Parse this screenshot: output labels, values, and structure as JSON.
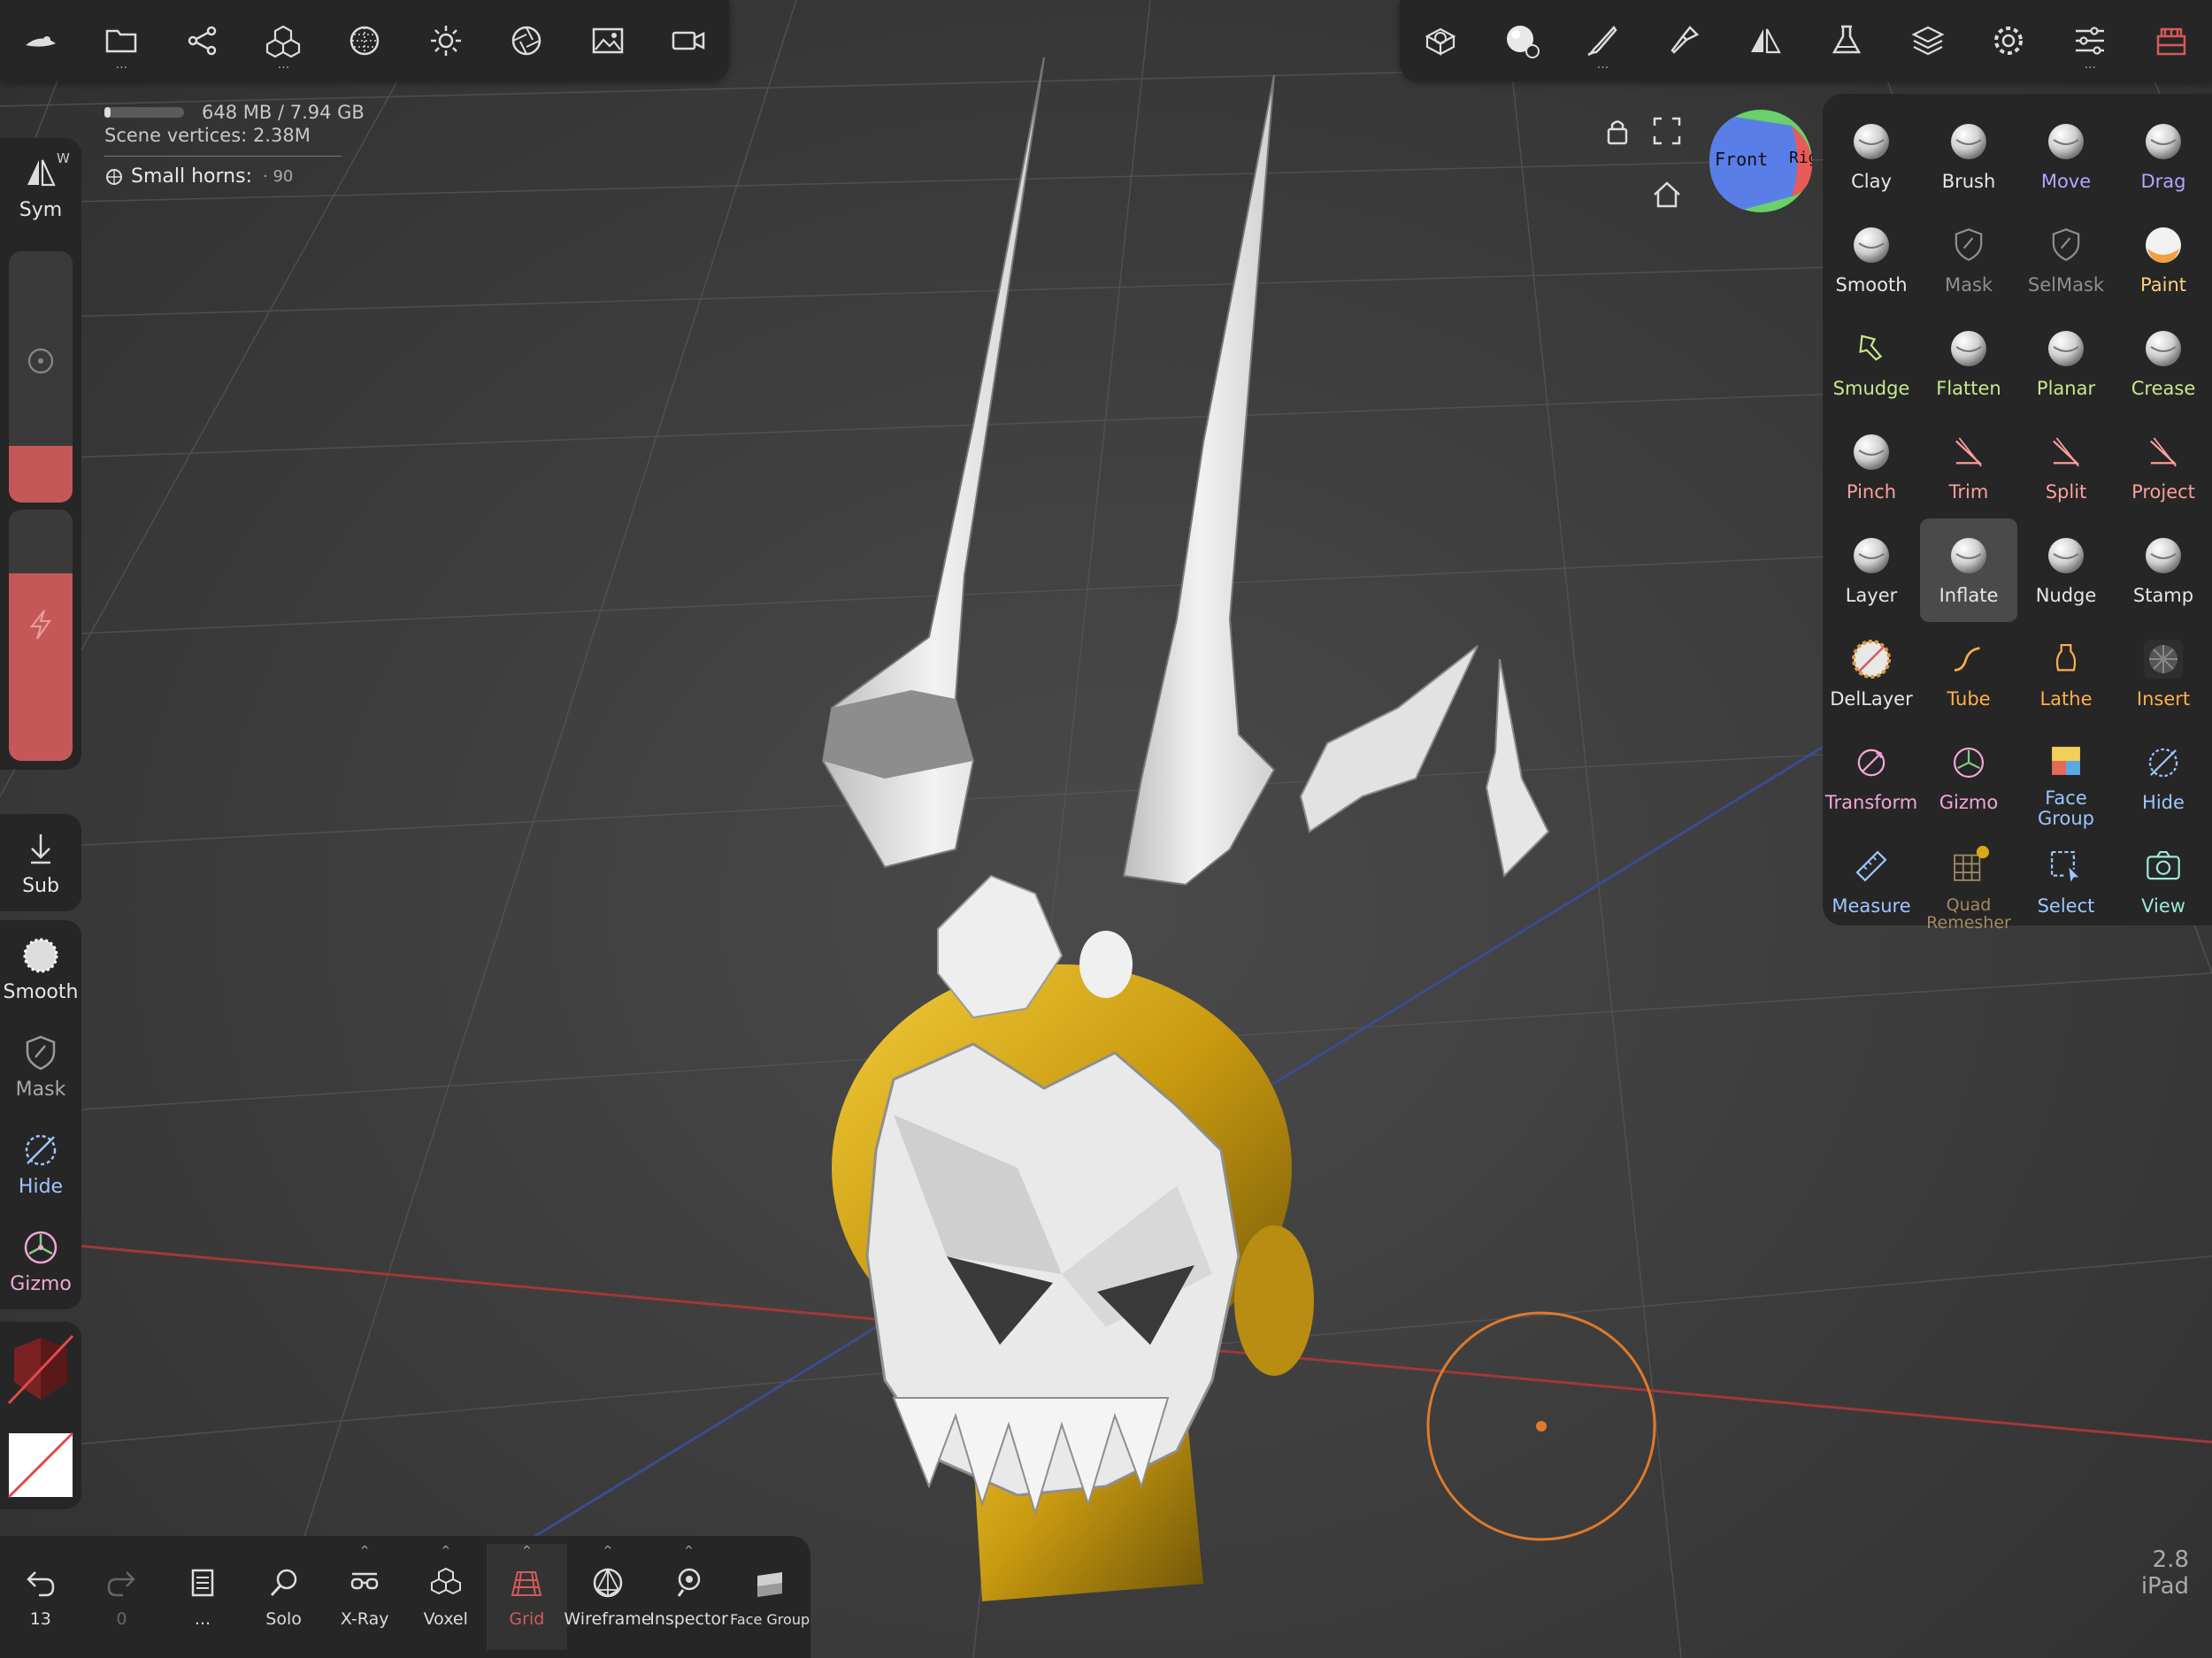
{
  "stats": {
    "memory": "648 MB / 7.94 GB",
    "memory_fraction": 0.08,
    "vertices_label": "Scene vertices",
    "vertices_value": "2.38M",
    "selected_object": "Small horns",
    "selected_value": "90"
  },
  "top_left_toolbar": [
    {
      "name": "logo-icon"
    },
    {
      "name": "folder-icon"
    },
    {
      "name": "scene-icon"
    },
    {
      "name": "primitives-icon"
    },
    {
      "name": "background-icon"
    },
    {
      "name": "light-icon"
    },
    {
      "name": "camera-lens-icon"
    },
    {
      "name": "image-icon"
    },
    {
      "name": "video-icon"
    }
  ],
  "top_right_toolbar": [
    {
      "name": "topology-icon"
    },
    {
      "name": "material-icon"
    },
    {
      "name": "paint-brush-icon"
    },
    {
      "name": "stroke-icon"
    },
    {
      "name": "symmetry-icon"
    },
    {
      "name": "flask-icon"
    },
    {
      "name": "layers-icon"
    },
    {
      "name": "settings-icon"
    },
    {
      "name": "sliders-icon"
    },
    {
      "name": "store-icon"
    }
  ],
  "left_panel": {
    "sym": {
      "label": "Sym",
      "key": "W"
    },
    "sub": {
      "label": "Sub"
    },
    "shortcuts": [
      {
        "label": "Smooth",
        "color": "#e6e6e6",
        "icon": "smooth-icon"
      },
      {
        "label": "Mask",
        "color": "#a9a9a9",
        "icon": "mask-icon"
      },
      {
        "label": "Hide",
        "color": "#9ec6ff",
        "icon": "hide-icon"
      },
      {
        "label": "Gizmo",
        "color": "#f3a7d8",
        "icon": "gizmo-icon"
      }
    ]
  },
  "tools": [
    {
      "label": "Clay",
      "color": "#e6e6e6"
    },
    {
      "label": "Brush",
      "color": "#e6e6e6"
    },
    {
      "label": "Move",
      "color": "#b7a4ff"
    },
    {
      "label": "Drag",
      "color": "#b7a4ff"
    },
    {
      "label": "Smooth",
      "color": "#e6e6e6"
    },
    {
      "label": "Mask",
      "color": "#8f8f8f"
    },
    {
      "label": "SelMask",
      "color": "#8f8f8f"
    },
    {
      "label": "Paint",
      "color": "#ffd27a"
    },
    {
      "label": "Smudge",
      "color": "#c6e88d"
    },
    {
      "label": "Flatten",
      "color": "#c6e88d"
    },
    {
      "label": "Planar",
      "color": "#c6e88d"
    },
    {
      "label": "Crease",
      "color": "#c6e88d"
    },
    {
      "label": "Pinch",
      "color": "#ff9e9e"
    },
    {
      "label": "Trim",
      "color": "#ff9e9e"
    },
    {
      "label": "Split",
      "color": "#ff9e9e"
    },
    {
      "label": "Project",
      "color": "#ff9e9e"
    },
    {
      "label": "Layer",
      "color": "#e6e6e6"
    },
    {
      "label": "Inflate",
      "color": "#e6e6e6"
    },
    {
      "label": "Nudge",
      "color": "#e6e6e6"
    },
    {
      "label": "Stamp",
      "color": "#e6e6e6"
    },
    {
      "label": "DelLayer",
      "color": "#e6e6e6"
    },
    {
      "label": "Tube",
      "color": "#ffb04a"
    },
    {
      "label": "Lathe",
      "color": "#ffb04a"
    },
    {
      "label": "Insert",
      "color": "#ffb04a"
    },
    {
      "label": "Transform",
      "color": "#f3a7d8"
    },
    {
      "label": "Gizmo",
      "color": "#f3a7d8"
    },
    {
      "label": "Face Group",
      "color": "#9ec6ff"
    },
    {
      "label": "Hide",
      "color": "#9ec6ff"
    },
    {
      "label": "Measure",
      "color": "#9ec6ff"
    },
    {
      "label": "Quad Remesher",
      "color": "#a38a60"
    },
    {
      "label": "Select",
      "color": "#9ec6ff"
    },
    {
      "label": "View",
      "color": "#9ee8d8"
    }
  ],
  "selected_tool": "Inflate",
  "bottom_bar": [
    {
      "label": "13",
      "name": "undo-button",
      "icon": "undo-icon"
    },
    {
      "label": "0",
      "name": "redo-button",
      "icon": "redo-icon"
    },
    {
      "label": "...",
      "name": "history-button",
      "icon": "history-icon"
    },
    {
      "label": "Solo",
      "name": "solo-button",
      "icon": "solo-icon"
    },
    {
      "label": "X-Ray",
      "name": "xray-button",
      "icon": "xray-icon"
    },
    {
      "label": "Voxel",
      "name": "voxel-button",
      "icon": "voxel-icon"
    },
    {
      "label": "Grid",
      "name": "grid-button",
      "icon": "grid-icon"
    },
    {
      "label": "Wireframe",
      "name": "wireframe-button",
      "icon": "wireframe-icon"
    },
    {
      "label": "Inspector",
      "name": "inspector-button",
      "icon": "inspector-icon"
    },
    {
      "label": "Face Group",
      "name": "face-group-button",
      "icon": "face-group-icon"
    }
  ],
  "navcube": {
    "front": "Front",
    "right": "Right"
  },
  "version": {
    "number": "2.8",
    "device": "iPad"
  },
  "colors": {
    "panel": "#262626",
    "accent": "#c45858",
    "brush_ring": "#e07a2a",
    "gold": "#d8a818"
  }
}
